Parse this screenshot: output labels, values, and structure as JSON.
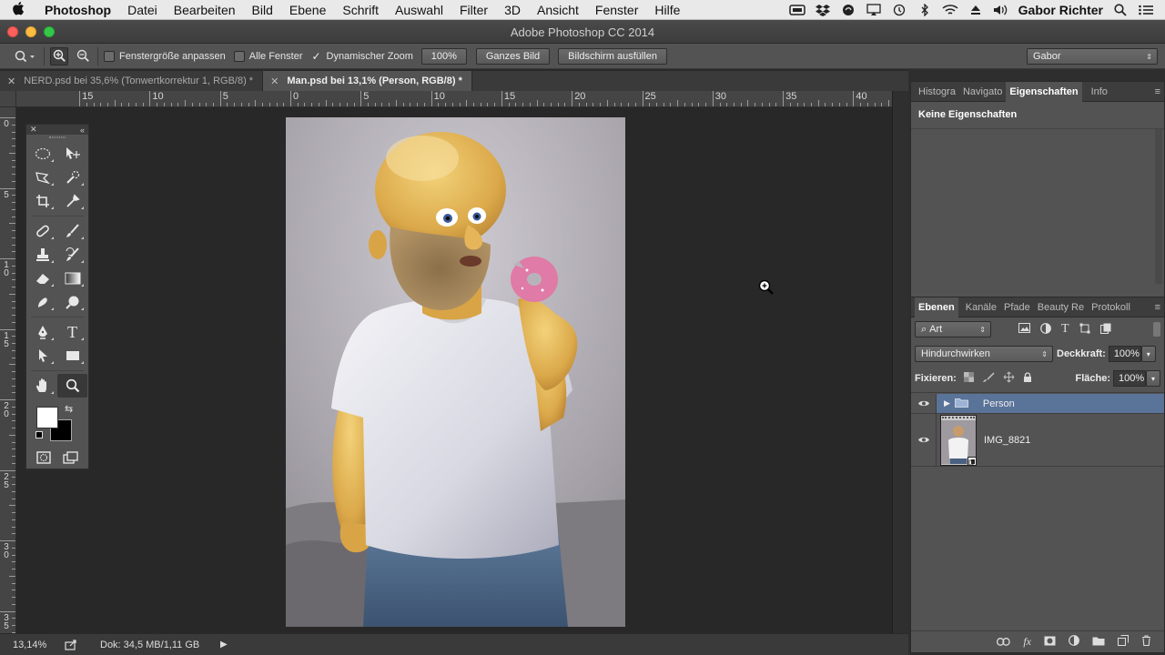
{
  "menubar": {
    "apple": "",
    "items": [
      "Photoshop",
      "Datei",
      "Bearbeiten",
      "Bild",
      "Ebene",
      "Schrift",
      "Auswahl",
      "Filter",
      "3D",
      "Ansicht",
      "Fenster",
      "Hilfe"
    ],
    "user": "Gabor Richter",
    "tray_icons": [
      "wacom-icon",
      "dropbox-icon",
      "evernote-icon",
      "airplay-icon",
      "time-machine-icon",
      "bluetooth-icon",
      "wifi-icon",
      "eject-icon",
      "volume-icon"
    ]
  },
  "window": {
    "title": "Adobe Photoshop CC 2014"
  },
  "options": {
    "fit_window": "Fenstergröße anpassen",
    "all_windows": "Alle Fenster",
    "dynamic_zoom": "Dynamischer Zoom",
    "dynamic_zoom_checked": true,
    "zoom_value": "100%",
    "fit_screen": "Ganzes Bild",
    "fill_screen": "Bildschirm ausfüllen",
    "workspace": "Gabor"
  },
  "tabs": [
    {
      "label": "NERD.psd bei 35,6% (Tonwertkorrektur 1, RGB/8) *",
      "active": false
    },
    {
      "label": "Man.psd bei 13,1% (Person, RGB/8) *",
      "active": true
    }
  ],
  "rulers": {
    "h_labels": [
      "15",
      "10",
      "5",
      "0",
      "5",
      "10",
      "15",
      "20",
      "25",
      "30",
      "35",
      "40"
    ],
    "v_labels": [
      "0",
      "5",
      "1\n0",
      "1\n5",
      "2\n0",
      "2\n5",
      "3\n0",
      "3\n5"
    ]
  },
  "status": {
    "zoom": "13,14%",
    "doc": "Dok: 34,5 MB/1,11 GB"
  },
  "properties_panel": {
    "tabs": [
      "Histogra",
      "Navigato",
      "Eigenschaften",
      "Info"
    ],
    "active_tab": "Eigenschaften",
    "content": "Keine Eigenschaften"
  },
  "layers_panel": {
    "tabs": [
      "Ebenen",
      "Kanäle",
      "Pfade",
      "Beauty Re",
      "Protokoll"
    ],
    "active_tab": "Ebenen",
    "filter_kind": "Art",
    "blend_mode": "Hindurchwirken",
    "opacity_label": "Deckkraft:",
    "opacity_value": "100%",
    "lock_label": "Fixieren:",
    "fill_label": "Fläche:",
    "fill_value": "100%",
    "layers": [
      {
        "name": "Person",
        "type": "group",
        "selected": true
      },
      {
        "name": "IMG_8821",
        "type": "smart-object",
        "selected": false
      }
    ]
  },
  "colors": {
    "accent_selected_layer": "#5a7399",
    "panel_bg": "#535353",
    "workspace_bg": "#282828"
  }
}
